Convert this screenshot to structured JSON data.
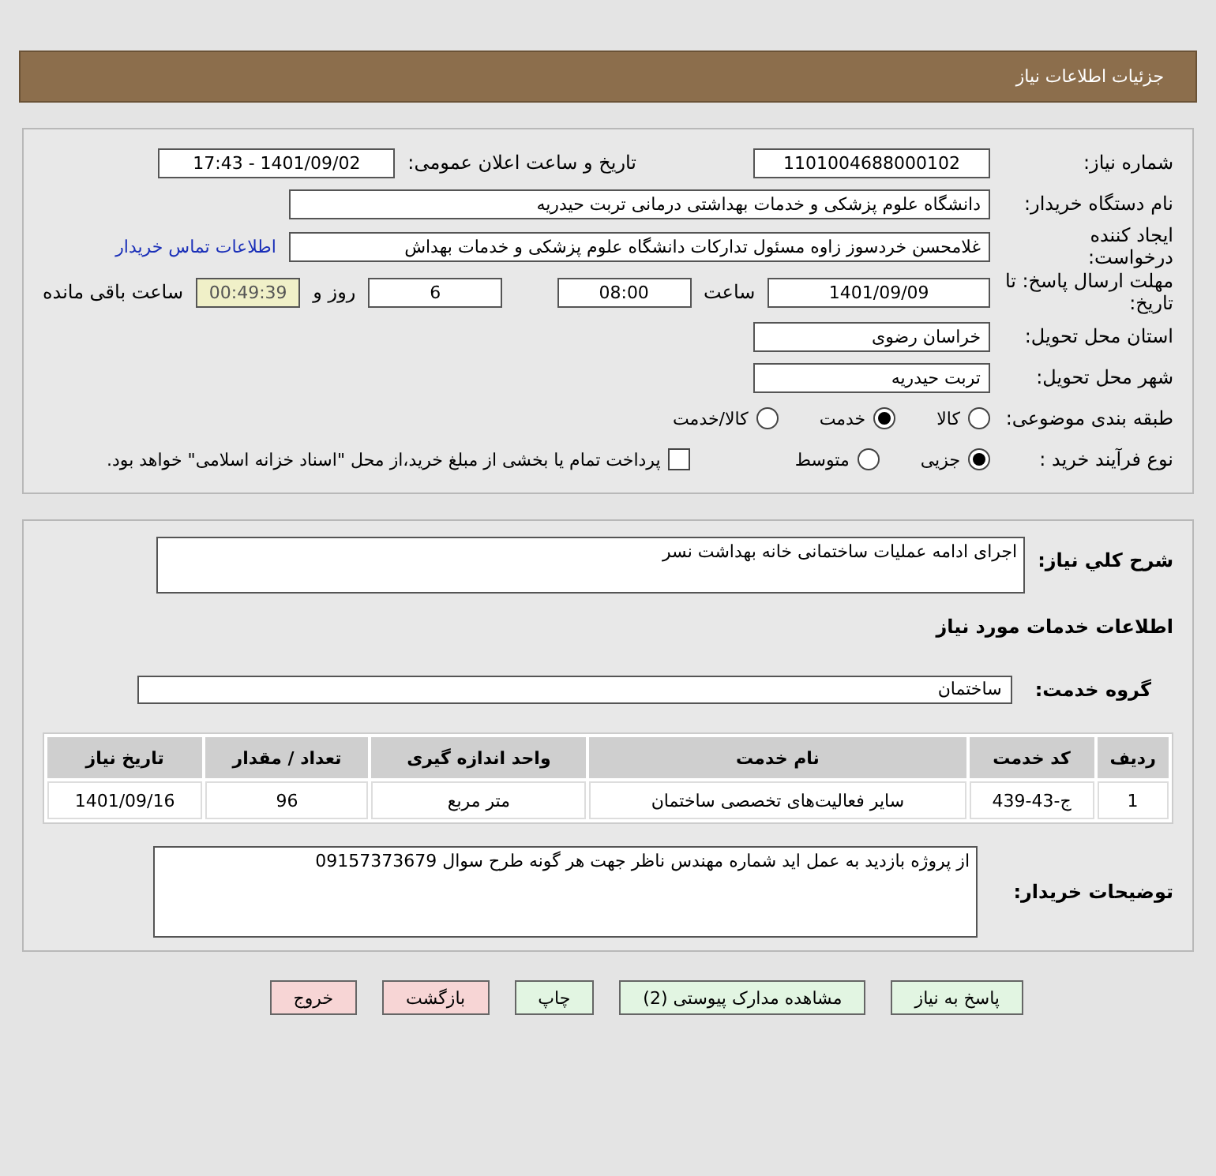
{
  "header": {
    "title": "جزئیات اطلاعات نیاز"
  },
  "need_number": {
    "label": "شماره نیاز:",
    "value": "1101004688000102"
  },
  "announce": {
    "label": "تاریخ و ساعت اعلان عمومی:",
    "value": "1401/09/02 - 17:43"
  },
  "buyer_org": {
    "label": "نام دستگاه خریدار:",
    "value": "دانشگاه علوم پزشکی و خدمات بهداشتی درمانی تربت حیدریه"
  },
  "requester": {
    "label": "ایجاد کننده درخواست:",
    "value": "غلامحسن خردسوز زاوه مسئول تدارکات دانشگاه علوم پزشکی و خدمات بهداش",
    "link": "اطلاعات تماس خریدار"
  },
  "deadline": {
    "label": "مهلت ارسال پاسخ: تا تاریخ:",
    "date": "1401/09/09",
    "time_label": "ساعت",
    "time": "08:00",
    "days": "6",
    "days_label": "روز و",
    "remaining": "00:49:39",
    "remaining_label": "ساعت باقی مانده"
  },
  "province": {
    "label": "استان محل تحویل:",
    "value": "خراسان رضوی"
  },
  "city": {
    "label": "شهر محل تحویل:",
    "value": "تربت حیدریه"
  },
  "category": {
    "label": "طبقه بندی موضوعی:",
    "options": [
      {
        "label": "کالا",
        "selected": false
      },
      {
        "label": "خدمت",
        "selected": true
      },
      {
        "label": "کالا/خدمت",
        "selected": false
      }
    ]
  },
  "process": {
    "label": "نوع فرآیند خرید :",
    "options": [
      {
        "label": "جزیی",
        "selected": true
      },
      {
        "label": "متوسط",
        "selected": false
      }
    ],
    "payment": {
      "label": "پرداخت تمام یا بخشی از مبلغ خرید،از محل \"اسناد خزانه اسلامی\" خواهد بود.",
      "checked": false
    }
  },
  "description": {
    "label": "شرح کلي نياز:",
    "value": "اجرای ادامه عملیات ساختمانی خانه بهداشت نسر"
  },
  "services_title": "اطلاعات خدمات مورد نیاز",
  "service_group": {
    "label": "گروه خدمت:",
    "value": "ساختمان"
  },
  "table": {
    "columns": [
      "ردیف",
      "کد خدمت",
      "نام خدمت",
      "واحد اندازه گیری",
      "تعداد / مقدار",
      "تاریخ نیاز"
    ],
    "rows": [
      [
        "1",
        "ج-43-439",
        "سایر فعالیت‌های تخصصی ساختمان",
        "متر مربع",
        "96",
        "1401/09/16"
      ]
    ]
  },
  "buyer_notes": {
    "label": "توضیحات خریدار:",
    "value": "از پروژه بازدید به عمل اید شماره مهندس ناظر جهت هر گونه طرح سوال 09157373679"
  },
  "buttons": [
    {
      "label": "پاسخ به نیاز",
      "kind": "normal"
    },
    {
      "label": "مشاهده مدارک پیوستی (2)",
      "kind": "normal"
    },
    {
      "label": "چاپ",
      "kind": "normal"
    },
    {
      "label": "بازگشت",
      "kind": "warn"
    },
    {
      "label": "خروج",
      "kind": "warn"
    }
  ]
}
